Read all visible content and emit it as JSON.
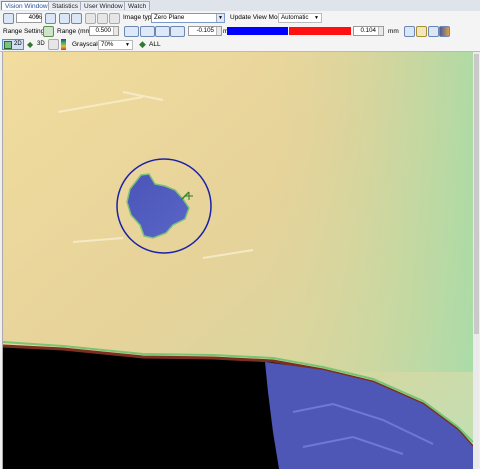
{
  "tabs": [
    {
      "label": "Vision Window",
      "active": true
    },
    {
      "label": "Statistics",
      "active": false
    },
    {
      "label": "User Window 1",
      "active": false
    },
    {
      "label": "Watch",
      "active": false
    }
  ],
  "toolbar": {
    "zoom_value": "400",
    "zoom_unit": "%",
    "image_type_label": "Image type",
    "image_type_value": "Zero Plane",
    "update_view_mode_label": "Update View Mode",
    "update_view_mode_value": "Automatic",
    "range_settings_label": "Range Settings",
    "range_label": "Range (mm) ±",
    "range_value": "0.500",
    "range_low_value": "-0.105",
    "range_high_value": "0.104",
    "unit_mm": "mm",
    "btn_2d": "2D",
    "btn_3d": "3D",
    "grayscale_label": "Grayscale",
    "grayscale_value": "70%",
    "all_label": "ALL"
  },
  "colors": {
    "accent": "#1f4f9a",
    "bar_blue": "#0000ff",
    "bar_red": "#ff1010",
    "surface": "#e6d39a"
  }
}
